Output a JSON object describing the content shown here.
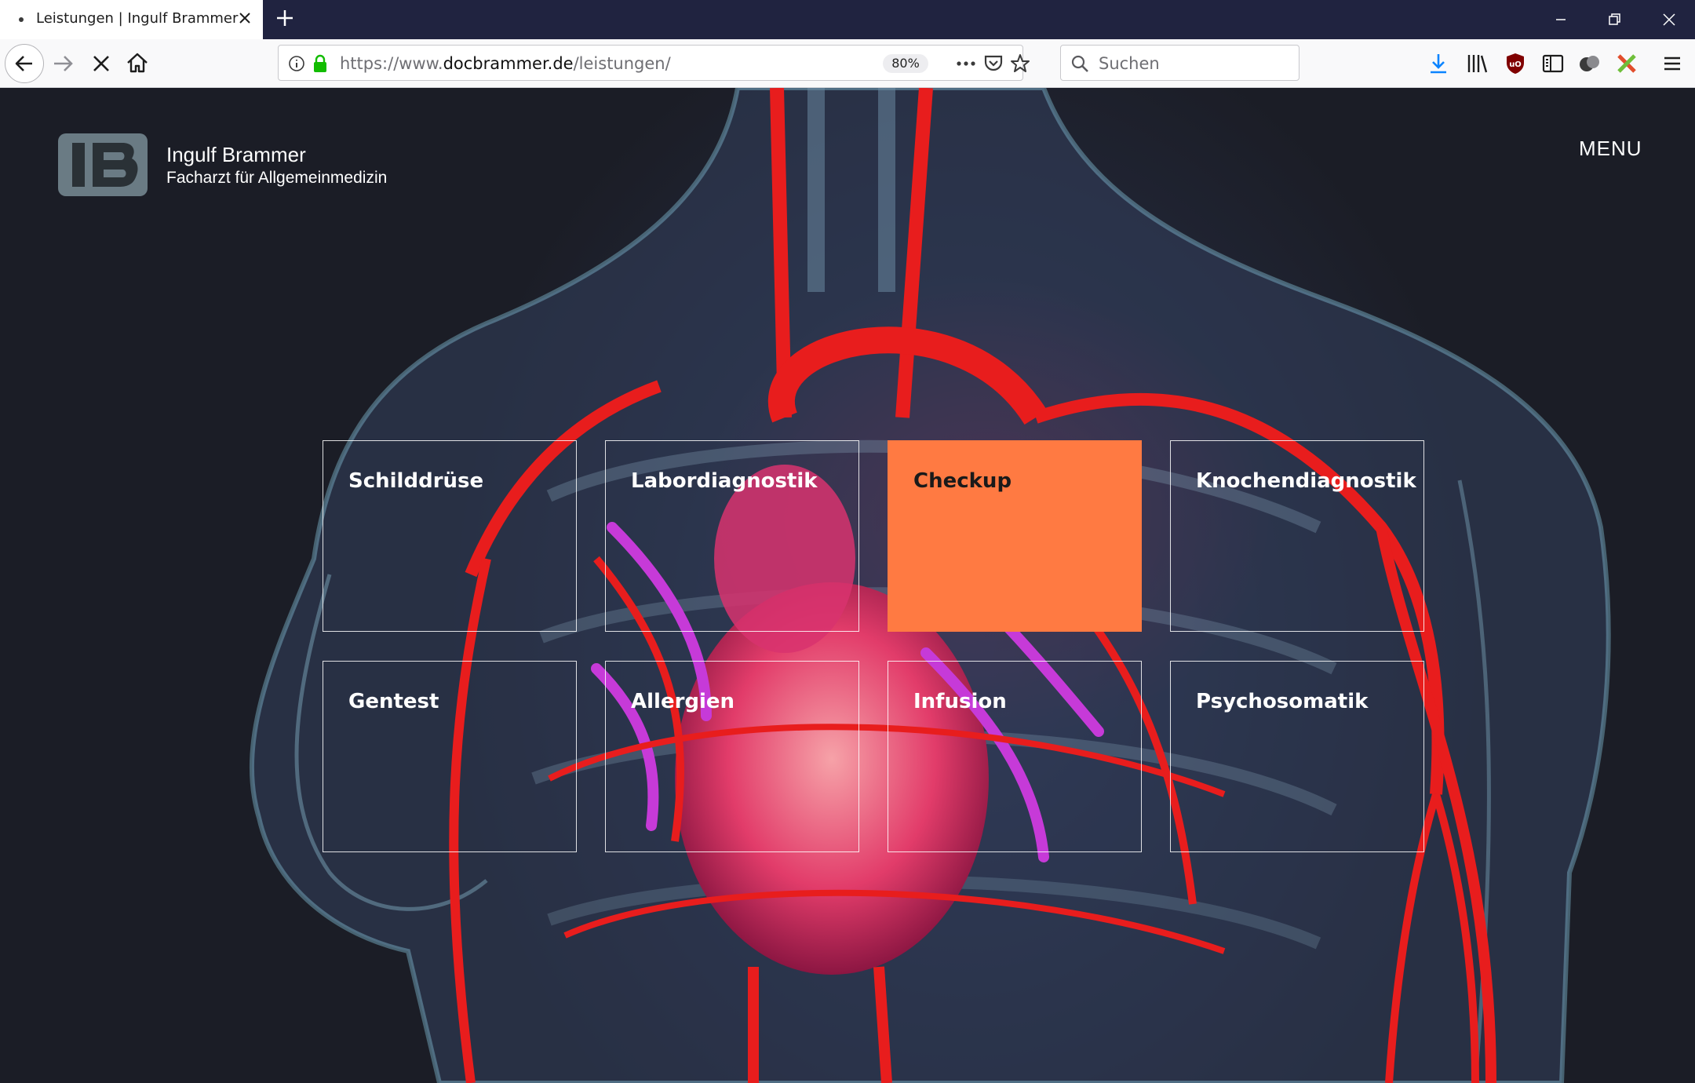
{
  "browser": {
    "tab_title": "Leistungen | Ingulf Brammer",
    "url_prefix": "https://www.",
    "url_domain": "docbrammer.de",
    "url_path": "/leistungen/",
    "zoom": "80%",
    "search_placeholder": "Suchen"
  },
  "site": {
    "logo_text": "IB",
    "name": "Ingulf Brammer",
    "subtitle": "Facharzt für Allgemeinmedizin",
    "menu_label": "MENU"
  },
  "services": [
    {
      "label": "Schilddrüse",
      "active": false
    },
    {
      "label": "Labordiagnostik",
      "active": false
    },
    {
      "label": "Checkup",
      "active": true
    },
    {
      "label": "Knochendiagnostik",
      "active": false
    },
    {
      "label": "Gentest",
      "active": false
    },
    {
      "label": "Allergien",
      "active": false
    },
    {
      "label": "Infusion",
      "active": false
    },
    {
      "label": "Psychosomatik",
      "active": false
    }
  ],
  "colors": {
    "accent": "#ff7a42",
    "tabbar": "#202340",
    "page_bg": "#1b1d26",
    "artery": "#e81d1d",
    "vein": "#c63ad8"
  }
}
